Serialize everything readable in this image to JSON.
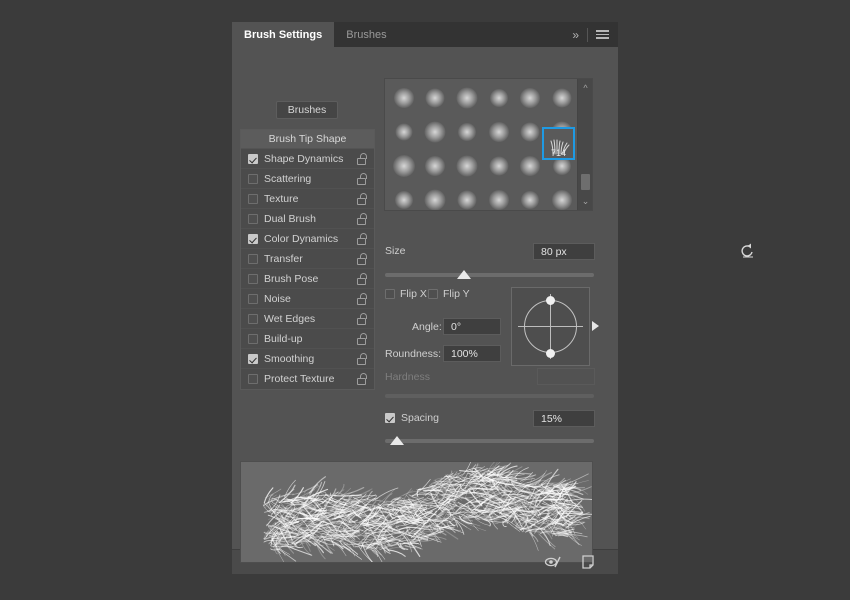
{
  "panel": {
    "tabs": [
      {
        "label": "Brush Settings",
        "active": true
      },
      {
        "label": "Brushes",
        "active": false
      }
    ],
    "collapse_icon": "double-chevron-right-icon",
    "menu_icon": "hamburger-menu-icon",
    "brushes_button_label": "Brushes"
  },
  "options": {
    "header": "Brush Tip Shape",
    "items": [
      {
        "label": "Shape Dynamics",
        "checked": true,
        "lock": true
      },
      {
        "label": "Scattering",
        "checked": false,
        "lock": true
      },
      {
        "label": "Texture",
        "checked": false,
        "lock": true
      },
      {
        "label": "Dual Brush",
        "checked": false,
        "lock": true
      },
      {
        "label": "Color Dynamics",
        "checked": true,
        "lock": true
      },
      {
        "label": "Transfer",
        "checked": false,
        "lock": true
      },
      {
        "label": "Brush Pose",
        "checked": false,
        "lock": true
      },
      {
        "label": "Noise",
        "checked": false,
        "lock": true
      },
      {
        "label": "Wet Edges",
        "checked": false,
        "lock": true
      },
      {
        "label": "Build-up",
        "checked": false,
        "lock": true
      },
      {
        "label": "Smoothing",
        "checked": true,
        "lock": true
      },
      {
        "label": "Protect Texture",
        "checked": false,
        "lock": true
      }
    ]
  },
  "brush_grid": {
    "selected_brush_number": "714",
    "selection_color": "#1f9ae3",
    "scrollbar": {
      "up_icon": "chevron-up-icon",
      "down_icon": "chevron-down-icon"
    }
  },
  "controls": {
    "size": {
      "label": "Size",
      "value": "80 px",
      "reset_icon": "reset-arrow-icon",
      "slider_percent": 35
    },
    "flip_x": {
      "label": "Flip X",
      "checked": false
    },
    "flip_y": {
      "label": "Flip Y",
      "checked": false
    },
    "angle": {
      "label": "Angle:",
      "value": "0°"
    },
    "roundness": {
      "label": "Roundness:",
      "value": "100%"
    },
    "hardness": {
      "label": "Hardness",
      "value": "",
      "disabled": true
    },
    "spacing": {
      "label": "Spacing",
      "value": "15%",
      "checked": true,
      "slider_percent": 4
    }
  },
  "preview": {
    "stroke_description": "grass-brush-stroke-preview"
  },
  "footer": {
    "icons": [
      {
        "name": "toggle-live-tip-brush-preview-icon"
      },
      {
        "name": "new-brush-preset-icon"
      }
    ]
  },
  "colors": {
    "app_background": "#3b3b3b",
    "panel_background": "#535353",
    "tabbar_background": "#333333",
    "accent": "#1f9ae3"
  }
}
